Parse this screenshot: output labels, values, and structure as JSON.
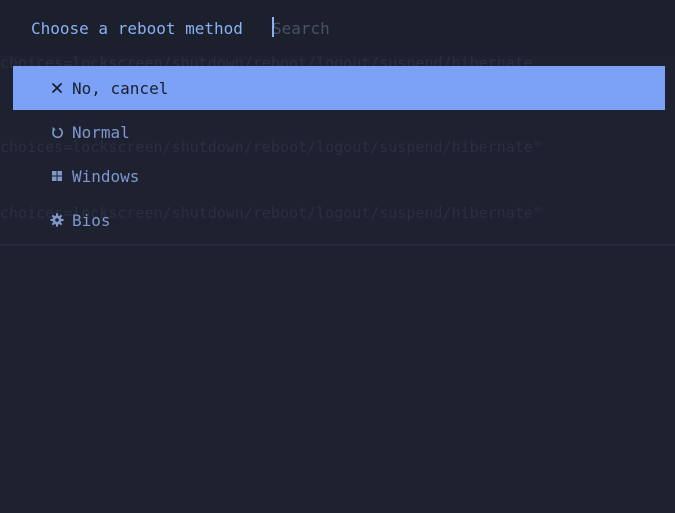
{
  "header": {
    "prompt": "Choose a reboot method",
    "search_placeholder": "Search",
    "search_value": ""
  },
  "items": [
    {
      "label": "No, cancel",
      "icon": "close-icon",
      "selected": true
    },
    {
      "label": "Normal",
      "icon": "power-cycle-icon",
      "selected": false
    },
    {
      "label": "Windows",
      "icon": "windows-icon",
      "selected": false
    },
    {
      "label": "Bios",
      "icon": "gear-icon",
      "selected": false
    }
  ],
  "background_text": [
    "choices=lockscreen/shutdown/reboot/logout/suspend/hibernate",
    "choices=lockscreen/shutdown/reboot/logout/suspend/hibernate\"",
    "choices=lockscreen/shutdown/reboot/logout/suspend/hibernate\""
  ],
  "colors": {
    "accent": "#7ca2f7",
    "prompt": "#8ab0f6",
    "item_text": "#7f97cd",
    "background": "#1e2130"
  }
}
